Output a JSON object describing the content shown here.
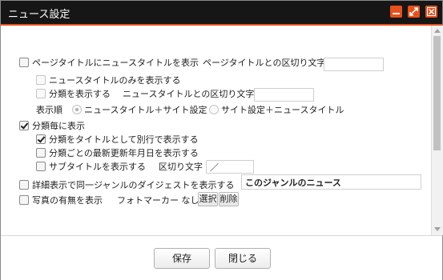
{
  "window": {
    "title": "ニュース設定"
  },
  "options": {
    "page_title": {
      "label": "ページタイトルにニュースタイトルを表示",
      "sep_label": "ページタイトルとの区切り文字",
      "sep_value": "",
      "checked": false
    },
    "news_title_only": {
      "label": "ニュースタイトルのみを表示する",
      "checked": false
    },
    "show_category": {
      "label": "分類を表示する",
      "sep_label": "ニュースタイトルとの区切り文字",
      "sep_value": "",
      "checked": false
    },
    "display_order": {
      "label": "表示順",
      "choices": [
        "ニュースタイトル＋サイト設定",
        "サイト設定＋ニュースタイトル"
      ],
      "selected": 0
    },
    "per_category": {
      "label": "分類毎に表示",
      "checked": true
    },
    "category_as_title": {
      "label": "分類をタイトルとして別行で表示する",
      "checked": true
    },
    "latest_update": {
      "label": "分類ごとの最新更新年月日を表示する",
      "checked": false
    },
    "subtitle": {
      "label": "サブタイトルを表示する",
      "sep_label": "区切り文字",
      "sep_value": "／",
      "checked": false
    },
    "digest": {
      "label": "詳細表示で同一ジャンルのダイジェストを表示する",
      "value": "このジャンルのニュース",
      "checked": false
    },
    "photo": {
      "label": "写真の有無を表示",
      "marker_label": "フォトマーカー なし",
      "select_label": "選択",
      "delete_label": "削除",
      "checked": false
    }
  },
  "footer": {
    "save_label": "保存",
    "close_label": "閉じる"
  },
  "colors": {
    "titlebar": "#161616",
    "accent": "#e8501c"
  }
}
